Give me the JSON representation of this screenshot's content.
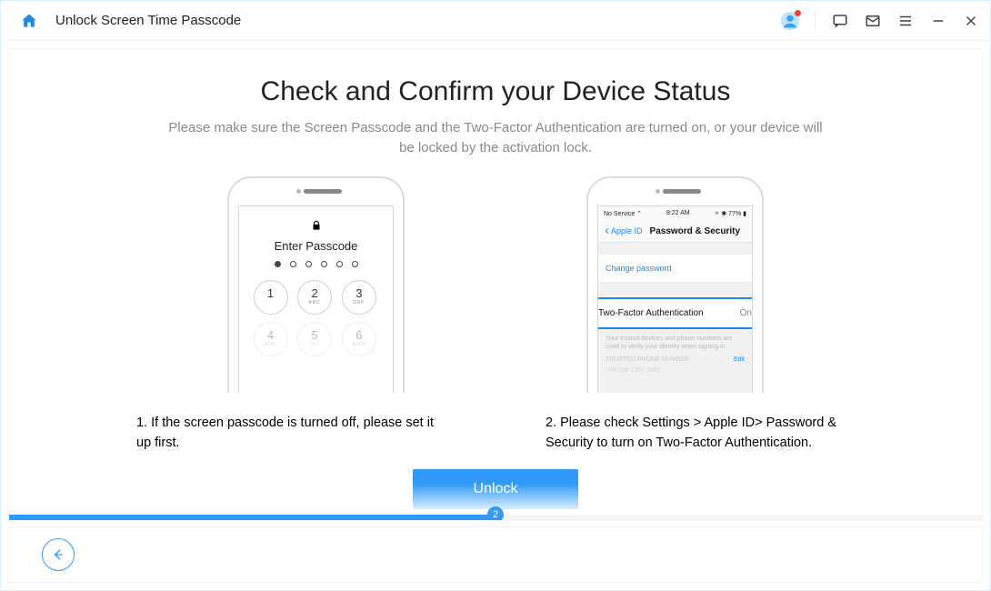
{
  "topbar": {
    "title": "Unlock Screen Time Passcode"
  },
  "main": {
    "heading": "Check and Confirm your Device Status",
    "subheading": "Please make sure the Screen Passcode and the Two-Factor Authentication are turned on, or your device will be locked by the activation lock.",
    "left": {
      "enter_passcode": "Enter Passcode",
      "keys": [
        {
          "n": "1",
          "l": ""
        },
        {
          "n": "2",
          "l": "ABC"
        },
        {
          "n": "3",
          "l": "DEF"
        },
        {
          "n": "4",
          "l": "GHI"
        },
        {
          "n": "5",
          "l": "JKL"
        },
        {
          "n": "6",
          "l": "MNO"
        }
      ],
      "caption": "1. If the screen passcode is turned off, please set it up first."
    },
    "right": {
      "status_left": "No Service ⌃",
      "status_mid": "8:22 AM",
      "status_right": "⚬ ✱ 77% ▮",
      "back_label": "Apple ID",
      "nav_title": "Password & Security",
      "change_password": "Change password",
      "tfa_label": "Two-Factor Authentication",
      "tfa_state": "On",
      "fine": "Your trusted devices and phone numbers are used to verify your identity when signing in.",
      "trusted_label": "TRUSTED PHONE NUMBER",
      "edit": "Edit",
      "phone_num": "+86 188 1357 3341",
      "caption": "2. Please check Settings > Apple ID> Password & Security to turn on Two-Factor Authentication."
    },
    "cta_label": "Unlock",
    "progress": {
      "step": "2"
    }
  }
}
